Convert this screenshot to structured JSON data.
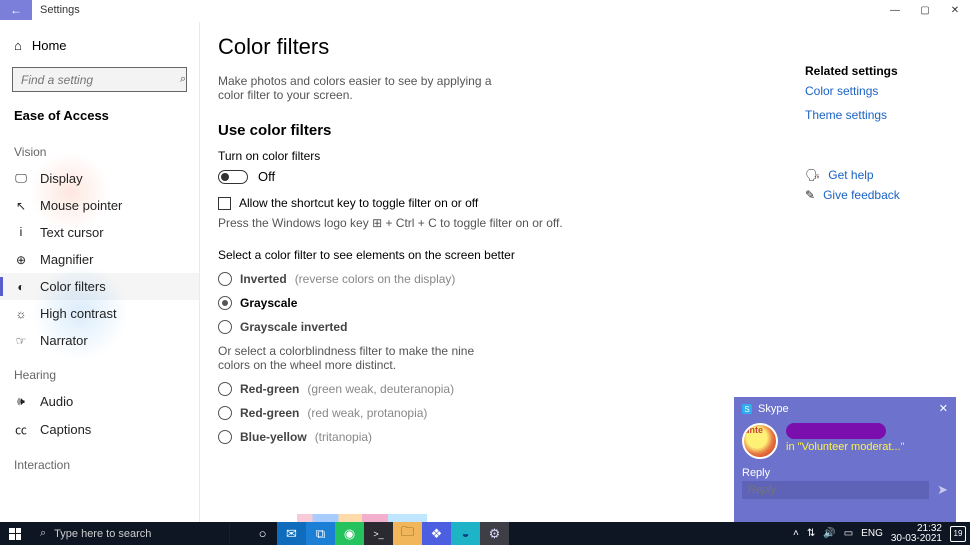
{
  "app": {
    "title": "Settings"
  },
  "window_controls": {
    "min": "—",
    "max": "▢",
    "close": "✕"
  },
  "sidebar": {
    "home": "Home",
    "search_placeholder": "Find a setting",
    "section": "Ease of Access",
    "groups": {
      "vision": {
        "label": "Vision",
        "items": [
          {
            "icon": "🖵",
            "label": "Display"
          },
          {
            "icon": "↖",
            "label": "Mouse pointer"
          },
          {
            "icon": "Ꭵ",
            "label": "Text cursor"
          },
          {
            "icon": "⊕",
            "label": "Magnifier"
          },
          {
            "icon": "◐",
            "label": "Color filters",
            "active": true
          },
          {
            "icon": "☼",
            "label": "High contrast"
          },
          {
            "icon": "☞",
            "label": "Narrator"
          }
        ]
      },
      "hearing": {
        "label": "Hearing",
        "items": [
          {
            "icon": "🕪",
            "label": "Audio"
          },
          {
            "icon": "㏄",
            "label": "Captions"
          }
        ]
      },
      "interaction": {
        "label": "Interaction",
        "items": []
      }
    }
  },
  "page": {
    "title": "Color filters",
    "desc": "Make photos and colors easier to see by applying a color filter to your screen.",
    "use_heading": "Use color filters",
    "toggle_label": "Turn on color filters",
    "toggle_state": "Off",
    "shortcut_chk": "Allow the shortcut key to toggle filter on or off",
    "shortcut_hint": "Press the Windows logo key ⊞ + Ctrl + C to toggle filter on or off.",
    "select_label": "Select a color filter to see elements on the screen better",
    "filters": [
      {
        "main": "Inverted",
        "sub": "(reverse colors on the display)",
        "selected": false
      },
      {
        "main": "Grayscale",
        "sub": "",
        "selected": true
      },
      {
        "main": "Grayscale inverted",
        "sub": "",
        "selected": false
      }
    ],
    "or_text": "Or select a colorblindness filter to make the nine colors on the wheel more distinct.",
    "cb_filters": [
      {
        "main": "Red-green",
        "sub": "(green weak, deuteranopia)"
      },
      {
        "main": "Red-green",
        "sub": "(red weak, protanopia)"
      },
      {
        "main": "Blue-yellow",
        "sub": "(tritanopia)"
      }
    ]
  },
  "related": {
    "heading": "Related settings",
    "links": [
      "Color settings",
      "Theme settings"
    ],
    "help": "Get help",
    "feedback": "Give feedback"
  },
  "toast": {
    "app": "Skype",
    "message": "in \"Volunteer moderat...\"",
    "reply_label": "Reply",
    "reply_placeholder": "Reply"
  },
  "taskbar": {
    "search_placeholder": "Type here to search",
    "apps": [
      {
        "name": "cortana",
        "glyph": "○",
        "bg": "#0e1623",
        "fg": "#fff"
      },
      {
        "name": "mail",
        "glyph": "✉",
        "bg": "#0f6cbd",
        "fg": "#fff"
      },
      {
        "name": "store",
        "glyph": "⧉",
        "bg": "#1c7fd6",
        "fg": "#fff"
      },
      {
        "name": "whatsapp",
        "glyph": "◉",
        "bg": "#24c35d",
        "fg": "#fff"
      },
      {
        "name": "terminal",
        "glyph": ">_",
        "bg": "#2a2a30",
        "fg": "#fff"
      },
      {
        "name": "explorer",
        "glyph": "🗀",
        "bg": "#f0b659",
        "fg": "#5a3a00"
      },
      {
        "name": "discord",
        "glyph": "❖",
        "bg": "#4c5fe0",
        "fg": "#fff"
      },
      {
        "name": "edge",
        "glyph": "◒",
        "bg": "#1eb3c6",
        "fg": "#0b3c80"
      },
      {
        "name": "settings",
        "glyph": "⚙",
        "bg": "#3e3e46",
        "fg": "#dcdcff"
      }
    ],
    "tray": {
      "lang": "ENG",
      "time": "21:32",
      "date": "30-03-2021",
      "notif": "19"
    }
  }
}
